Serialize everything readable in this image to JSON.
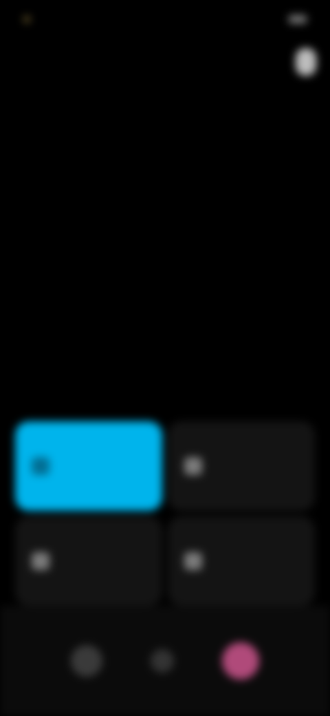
{
  "status": {
    "time": "",
    "indicators": ""
  },
  "header": {
    "title": "",
    "subtitle": ""
  },
  "date": {
    "main": "",
    "secondary": "",
    "sub": ""
  },
  "controls": {
    "section_label": "",
    "edit_label": "",
    "tiles": [
      {
        "label": "",
        "sub": ""
      },
      {
        "label": "",
        "sub": ""
      },
      {
        "label": "",
        "sub": ""
      },
      {
        "label": "",
        "sub": ""
      }
    ]
  },
  "colors": {
    "accent": "#00b4ec",
    "background": "#000000",
    "tile": "#141414",
    "nav_accent": "#b04a7a"
  },
  "icons": [
    "settings-icon",
    "home-icon",
    "search-icon",
    "power-icon"
  ]
}
